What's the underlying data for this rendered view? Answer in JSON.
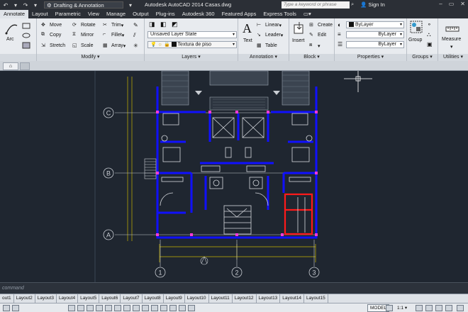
{
  "window": {
    "workspace": "Drafting & Annotation",
    "title": "Autodesk AutoCAD 2014    Casas.dwg",
    "search_placeholder": "Type a keyword or phrase",
    "sign_in": "Sign In"
  },
  "menu": {
    "tabs": [
      "Annotate",
      "Layout",
      "Parametric",
      "View",
      "Manage",
      "Output",
      "Plug-ins",
      "Autodesk 360",
      "Featured Apps",
      "Express Tools"
    ],
    "active_index": 0
  },
  "ribbon": {
    "draw": {
      "arc": "Arc"
    },
    "modify": {
      "title": "Modify",
      "move": "Move",
      "rotate": "Rotate",
      "trim": "Trim",
      "copy": "Copy",
      "mirror": "Mirror",
      "fillet": "Fillet",
      "stretch": "Stretch",
      "scale": "Scale",
      "array": "Array"
    },
    "layers": {
      "title": "Layers",
      "layer_state": "Unsaved Layer State",
      "current_layer": "Textura de piso"
    },
    "annotation": {
      "title": "Annotation",
      "text": "Text",
      "linear": "Linear",
      "leader": "Leader",
      "table": "Table"
    },
    "block": {
      "title": "Block",
      "insert": "Insert",
      "create": "Create",
      "edit": "Edit"
    },
    "properties": {
      "title": "Properties",
      "color": "ByLayer",
      "linetype": "ByLayer",
      "lineweight": "ByLayer"
    },
    "groups": {
      "title": "Groups",
      "group": "Group"
    },
    "utilities": {
      "title": "Utilities",
      "measure": "Measure"
    }
  },
  "drawing": {
    "grid_rows": [
      "C",
      "B",
      "A"
    ],
    "grid_cols": [
      "1",
      "2",
      "3"
    ]
  },
  "command_line": {
    "placeholder": "command"
  },
  "layout_tabs": [
    "out1",
    "Layout2",
    "Layout3",
    "Layout4",
    "Layout5",
    "Layout6",
    "Layout7",
    "Layout8",
    "Layout9",
    "Layout10",
    "Layout11",
    "Layout12",
    "Layout13",
    "Layout14",
    "Layout15"
  ],
  "status": {
    "model": "MODEL",
    "scale": "1:1"
  },
  "colors": {
    "wall": "#1010ff",
    "red_wall": "#ff1a1a",
    "background": "#1f2630",
    "dim": "#c8b400"
  }
}
